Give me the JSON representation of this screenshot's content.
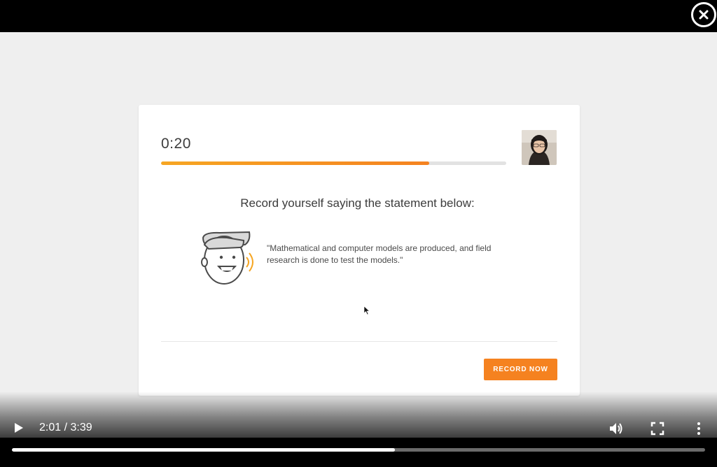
{
  "player": {
    "current_time": "2:01",
    "duration": "3:39",
    "time_display": "2:01 / 3:39",
    "played_fraction": 0.553
  },
  "card": {
    "timer": "0:20",
    "timer_progress_fraction": 0.776,
    "prompt_title": "Record yourself saying the statement below:",
    "statement": "\"Mathematical and computer models are produced, and field research is done to test the models.\"",
    "record_button_label": "RECORD NOW"
  },
  "icons": {
    "close": "close-icon",
    "play": "play-icon",
    "volume": "volume-icon",
    "fullscreen": "fullscreen-icon",
    "more": "more-vertical-icon",
    "mascot": "speaking-face-icon",
    "webcam": "webcam-preview"
  },
  "colors": {
    "accent": "#f58220",
    "accent_light": "#f6a623",
    "background": "#efefef",
    "card": "#ffffff",
    "text": "#3c3c3c"
  }
}
